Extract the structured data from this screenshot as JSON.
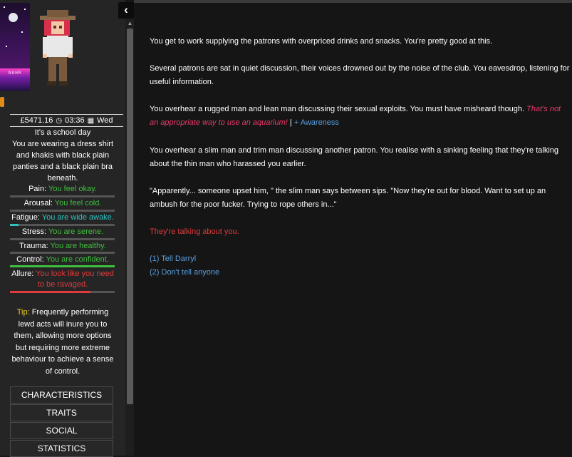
{
  "sidebar": {
    "collapse_icon": "chevron-left-icon",
    "city_sign": "NOHR",
    "status": {
      "money": "£5471.16",
      "time": "03:36",
      "day": "Wed",
      "clock_icon": "clock-icon",
      "calendar_icon": "calendar-icon"
    },
    "school_day": "It's a school day",
    "clothing": "You are wearing a dress shirt and khakis with black plain panties and a black plain bra beneath.",
    "stats": [
      {
        "label": "Pain:",
        "value": "You feel okay.",
        "color": "#3fbf3f",
        "bar_fraction": 0.0,
        "bar_color": "#3fbf3f"
      },
      {
        "label": "Arousal:",
        "value": "You feel cold.",
        "color": "#3fbf3f",
        "bar_fraction": 0.0,
        "bar_color": "#3fbf3f"
      },
      {
        "label": "Fatigue:",
        "value": "You are wide awake.",
        "color": "#2ec2c2",
        "bar_fraction": 0.08,
        "bar_color": "#2ec2c2"
      },
      {
        "label": "Stress:",
        "value": "You are serene.",
        "color": "#3fbf3f",
        "bar_fraction": 0.0,
        "bar_color": "#3fbf3f"
      },
      {
        "label": "Trauma:",
        "value": "You are healthy.",
        "color": "#3fbf3f",
        "bar_fraction": 0.0,
        "bar_color": "#3fbf3f"
      },
      {
        "label": "Control:",
        "value": "You are confident.",
        "color": "#3fbf3f",
        "bar_fraction": 1.0,
        "bar_color": "#3fbf3f"
      },
      {
        "label": "Allure:",
        "value": "You look like you need to be ravaged.",
        "color": "#e03a3a",
        "bar_fraction": 0.77,
        "bar_color": "#e03a3a"
      }
    ],
    "tip_label": "Tip:",
    "tip_text": "Frequently performing lewd acts will inure you to them, allowing more options but requiring more extreme behaviour to achieve a sense of control.",
    "buttons": [
      "CHARACTERISTICS",
      "TRAITS",
      "SOCIAL",
      "STATISTICS"
    ]
  },
  "passage": {
    "p1": "You get to work supplying the patrons with overpriced drinks and snacks. You're pretty good at this.",
    "p2": "Several patrons are sat in quiet discussion, their voices drowned out by the noise of the club. You eavesdrop, listening for useful information.",
    "p3_main": "You overhear a rugged man and lean man discussing their sexual exploits. You must have misheard though.",
    "p3_italic": "That's not an appropriate way to use an aquarium!",
    "p3_sep": "|",
    "p3_awareness": "+ Awareness",
    "p4": "You overhear a slim man and trim man discussing another patron. You realise with a sinking feeling that they're talking about the thin man who harassed you earlier.",
    "p5": "\"Apparently... someone upset him, \" the slim man says between sips. \"Now they're out for blood. Want to set up an ambush for the poor fucker. Trying to rope others in...\"",
    "p6": "They're talking about you.",
    "choices": [
      "(1) Tell Darryl",
      "(2) Don't tell anyone"
    ]
  }
}
